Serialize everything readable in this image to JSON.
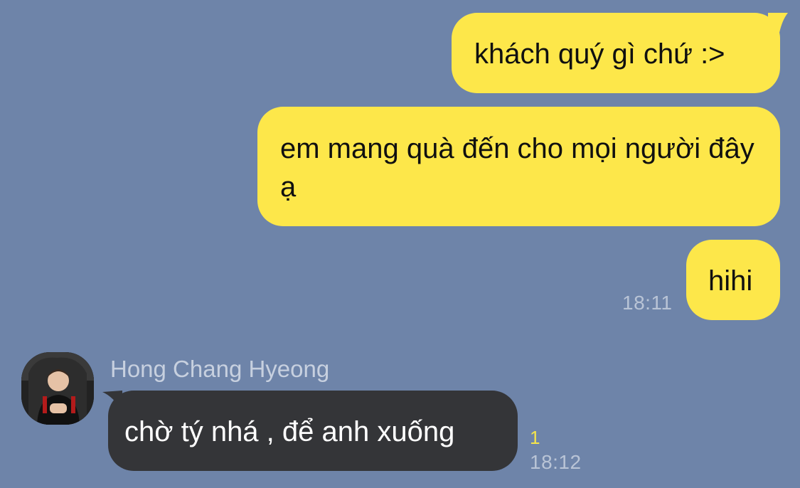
{
  "messages": [
    {
      "text": "khách quý gì chứ :>"
    },
    {
      "text": "em mang quà đến cho mọi người đây ạ"
    },
    {
      "text": "hihi",
      "time": "18:11"
    },
    {
      "text": "chờ tý nhá , để anh xuống",
      "sender": "Hong Chang Hyeong",
      "unread": "1",
      "time": "18:12"
    }
  ],
  "avatar_icon": "profile-photo-person-in-gaming-chair",
  "colors": {
    "background": "#6e84a9",
    "outgoing_bubble": "#fde74a",
    "incoming_bubble": "#343538",
    "unread_count": "#f5e54a",
    "timestamp": "#b9c4d6"
  }
}
